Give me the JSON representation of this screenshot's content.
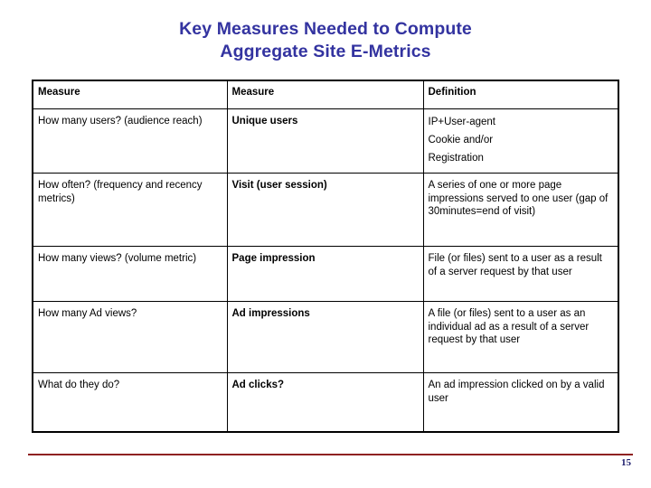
{
  "slide": {
    "title_line1": "Key Measures Needed to Compute",
    "title_line2": "Aggregate Site E-Metrics",
    "title_color": "#3333a0",
    "page_number": "15",
    "rule_color": "#8f2222",
    "page_number_color": "#1f1f6e"
  },
  "table": {
    "headers": {
      "col_a": "Measure",
      "col_b": "Measure",
      "col_c": "Definition"
    },
    "rows": [
      {
        "col_a": "How many users? (audience reach)",
        "col_b": "Unique users",
        "col_c_lines": {
          "l1": "IP+User-agent",
          "l2": "Cookie and/or",
          "l3": "Registration"
        }
      },
      {
        "col_a": "How often? (frequency and recency metrics)",
        "col_b": "Visit (user session)",
        "col_c": "A series of one or more page impressions served to one user (gap of 30minutes=end of visit)"
      },
      {
        "col_a": "How many views? (volume metric)",
        "col_b": "Page impression",
        "col_c": "File (or files) sent to a user as a result of a server request by that user"
      },
      {
        "col_a": "How many Ad views?",
        "col_b": "Ad impressions",
        "col_c": "A file (or files) sent to a user as an individual ad as a result of a server request by that user"
      },
      {
        "col_a": "What do they do?",
        "col_b": "Ad clicks?",
        "col_c": "An ad impression clicked on by a valid user"
      }
    ]
  }
}
